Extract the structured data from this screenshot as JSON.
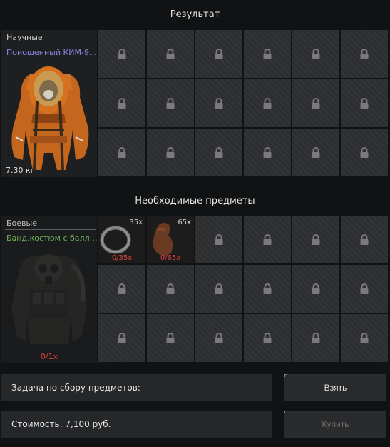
{
  "result": {
    "title": "Результат",
    "item": {
      "category": "Научные",
      "name": "Поношенный КИМ-9...",
      "weight": "7.30 кг"
    }
  },
  "required": {
    "title": "Необходимые предметы",
    "item": {
      "category": "Боевые",
      "name": "Банд.костюм с балло...",
      "have": "0/1x"
    },
    "components": [
      {
        "icon": "rope-ring-icon",
        "qty": "35x",
        "have": "0/35x"
      },
      {
        "icon": "brown-material-icon",
        "qty": "65x",
        "have": "0/65x"
      }
    ]
  },
  "task": {
    "label": "Задача по сбору предметов:"
  },
  "cost": {
    "label": "Стоимость: 7,100 руб."
  },
  "buttons": {
    "take": "Взять",
    "buy": "Купить"
  },
  "colors": {
    "result_name": "#8f84e6",
    "required_name": "#6fae58",
    "shortage": "#d9413b",
    "disabled_text": "#6e6e6e"
  }
}
